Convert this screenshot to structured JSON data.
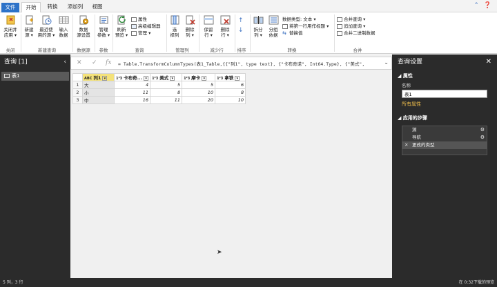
{
  "tabs": [
    "文件",
    "开始",
    "转换",
    "添加列",
    "视图"
  ],
  "ribbon": {
    "close_apply": "关闭并\n应用 ▾",
    "new_source": "新建\n源 ▾",
    "recent_sources": "最近使\n用的源 ▾",
    "enter_data": "输入\n数据",
    "data_source_settings": "数据\n源设置",
    "manage_params": "管理\n参数 ▾",
    "refresh_preview": "刷新\n预览 ▾",
    "properties": "属性",
    "advanced_editor": "高级编辑器",
    "manage": "管理 ▾",
    "choose_columns": "选\n择列",
    "remove_columns": "删除\n列 ▾",
    "keep_rows": "保留\n行 ▾",
    "remove_rows": "删除\n行 ▾",
    "sort_asc": "↑",
    "sort_desc": "↓",
    "split_column": "拆分\n列 ▾",
    "group_by": "分组\n依据",
    "data_type": "数据类型: 文本 ▾",
    "first_row_headers": "将第一行用作标题 ▾",
    "replace_values": "替换值",
    "merge_queries": "合并查询 ▾",
    "append_queries": "追加查询 ▾",
    "merge_binaries": "合并二进制数据",
    "groups": {
      "close": "关闭",
      "new_query": "新建查询",
      "data_source": "数据源",
      "params": "参数",
      "query": "查询",
      "manage_cols": "管理列",
      "reduce_rows": "减少行",
      "sort": "排序",
      "transform": "转换",
      "combine": "合并"
    }
  },
  "left_panel": {
    "title": "查询 [1]",
    "items": [
      "表1"
    ]
  },
  "formula": "= Table.TransformColumnTypes(表1_Table,{{\"列1\", type text}, {\"卡布奇诺\", Int64.Type}, {\"美式\",",
  "grid": {
    "headers": [
      "列1",
      "卡布奇...",
      "美式",
      "摩卡",
      "拿铁"
    ],
    "type_icons": [
      "ABC",
      "1²3",
      "1²3",
      "1²3",
      "1²3"
    ],
    "rows": [
      [
        "1",
        "大",
        "4",
        "5",
        "5",
        "6"
      ],
      [
        "2",
        "小",
        "11",
        "8",
        "10",
        "8"
      ],
      [
        "3",
        "中",
        "16",
        "11",
        "20",
        "10"
      ]
    ]
  },
  "right_panel": {
    "title": "查询设置",
    "properties_label": "属性",
    "name_label": "名称",
    "name_value": "表1",
    "all_properties": "所有属性",
    "applied_steps_label": "应用的步骤",
    "steps": [
      "源",
      "导航",
      "更改的类型"
    ]
  },
  "status": {
    "left": "5 列，3 行",
    "right": "在 0:32下载的预览"
  }
}
